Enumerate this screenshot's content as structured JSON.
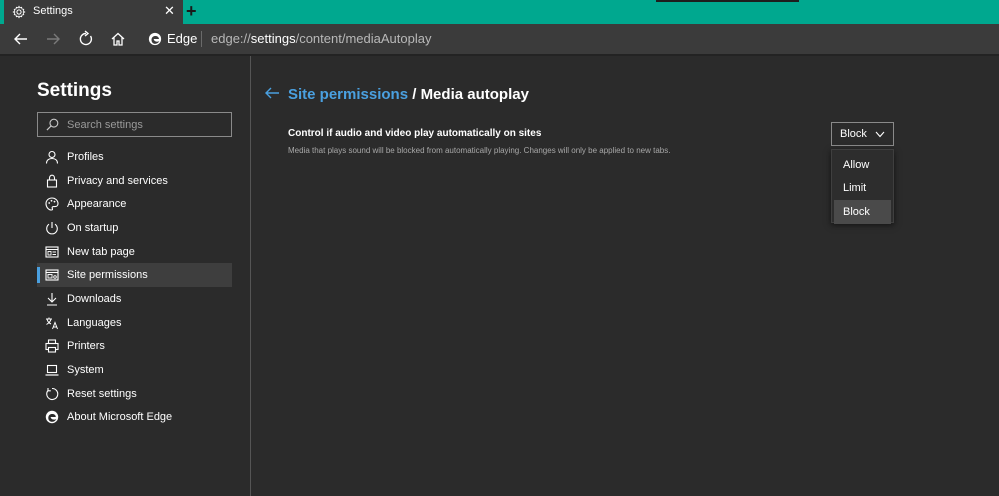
{
  "tab": {
    "title": "Settings",
    "close": "✕",
    "new_tab": "+"
  },
  "address": {
    "brand": "Edge",
    "url_prefix": "edge://",
    "url_host": "settings",
    "url_path": "/content/mediaAutoplay"
  },
  "sidebar": {
    "title": "Settings",
    "search_placeholder": "Search settings",
    "items": [
      {
        "label": "Profiles",
        "icon": "person-icon"
      },
      {
        "label": "Privacy and services",
        "icon": "lock-icon"
      },
      {
        "label": "Appearance",
        "icon": "palette-icon"
      },
      {
        "label": "On startup",
        "icon": "power-icon"
      },
      {
        "label": "New tab page",
        "icon": "new-tab-icon"
      },
      {
        "label": "Site permissions",
        "icon": "site-permissions-icon",
        "active": true
      },
      {
        "label": "Downloads",
        "icon": "download-icon"
      },
      {
        "label": "Languages",
        "icon": "languages-icon"
      },
      {
        "label": "Printers",
        "icon": "printer-icon"
      },
      {
        "label": "System",
        "icon": "laptop-icon"
      },
      {
        "label": "Reset settings",
        "icon": "reset-icon"
      },
      {
        "label": "About Microsoft Edge",
        "icon": "edge-logo-icon"
      }
    ]
  },
  "main": {
    "breadcrumb_link": "Site permissions",
    "breadcrumb_sep": " / ",
    "breadcrumb_current": "Media autoplay",
    "setting_title": "Control if audio and video play automatically on sites",
    "setting_desc": "Media that plays sound will be blocked from automatically playing. Changes will only be applied to new tabs.",
    "dropdown_value": "Block",
    "options": [
      "Allow",
      "Limit",
      "Block"
    ],
    "selected_option": "Block"
  },
  "colors": {
    "tab_strip": "#00a88f",
    "accent_link": "#4aa0e0",
    "background": "#2b2b2b"
  }
}
